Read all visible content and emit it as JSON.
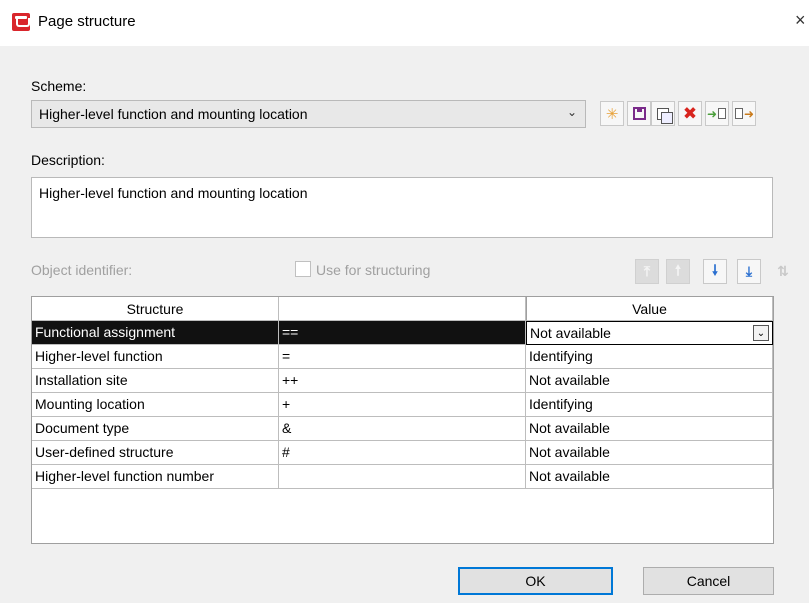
{
  "window": {
    "title": "Page structure",
    "close_glyph": "×"
  },
  "scheme": {
    "label": "Scheme:",
    "value": "Higher-level function and mounting location"
  },
  "toolbar": {
    "icons": [
      "new-icon",
      "save-icon",
      "copy-icon",
      "delete-icon",
      "import-icon",
      "export-icon"
    ]
  },
  "description": {
    "label": "Description:",
    "value": "Higher-level function and mounting location"
  },
  "object_identifier": {
    "label": "Object identifier:",
    "use_for_structuring_label": "Use for structuring",
    "use_for_structuring_checked": false,
    "enabled": false
  },
  "move_buttons": [
    "move-top-icon",
    "move-up-icon",
    "move-down-icon",
    "move-bottom-icon",
    "sort-icon"
  ],
  "grid": {
    "headers": [
      "Structure",
      "",
      "Value"
    ],
    "rows": [
      {
        "structure": "Functional assignment",
        "prefix": "==",
        "value": "Not available",
        "selected": true
      },
      {
        "structure": "Higher-level function",
        "prefix": "=",
        "value": "Identifying"
      },
      {
        "structure": "Installation site",
        "prefix": "++",
        "value": "Not available"
      },
      {
        "structure": "Mounting location",
        "prefix": "+",
        "value": "Identifying"
      },
      {
        "structure": "Document type",
        "prefix": "&",
        "value": "Not available"
      },
      {
        "structure": "User-defined structure",
        "prefix": "#",
        "value": "Not available"
      },
      {
        "structure": "Higher-level function number",
        "prefix": "",
        "value": "Not available"
      }
    ]
  },
  "buttons": {
    "ok": "OK",
    "cancel": "Cancel"
  },
  "colors": {
    "selection_bg": "#111111",
    "accent_focus": "#0078d7",
    "app_icon": "#d9262c"
  }
}
